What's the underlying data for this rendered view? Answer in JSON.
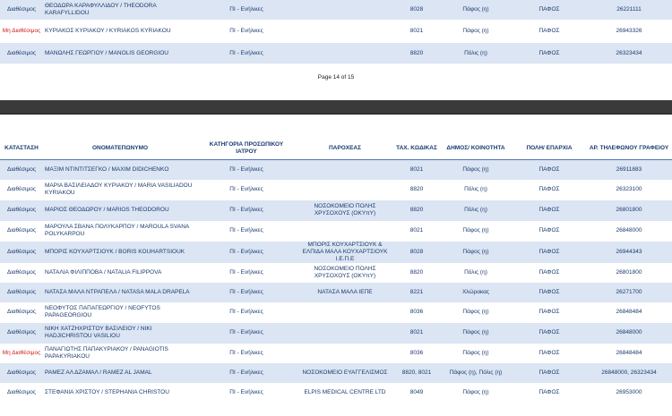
{
  "top_rows": [
    {
      "status": "Διαθέσιμος",
      "name": "ΘΕΟΔΩΡΑ ΚΑΡΑΦΥΛΛΙΔΟΥ / THEODORA KARAFYLLIDOU",
      "category": "ΠΙ - Ενήλικες",
      "provider": "",
      "postcode": "8028",
      "municipality": "Πάφος (η)",
      "district": "ΠΑΦΟΣ",
      "phone": "26221111"
    },
    {
      "status": "Μη Διαθέσιμος",
      "name": "ΚΥΡΙΑΚΟΣ ΚΥΡΙΑΚΟΥ / KYRIAKOS KYRIAKOU",
      "category": "ΠΙ - Ενήλικες",
      "provider": "",
      "postcode": "8021",
      "municipality": "Πάφος (η)",
      "district": "ΠΑΦΟΣ",
      "phone": "26943326"
    },
    {
      "status": "Διαθέσιμος",
      "name": "ΜΑΝΩΛΗΣ ΓΕΩΡΓΙΟΥ / MANOLIS GEORGIOU",
      "category": "ΠΙ - Ενήλικες",
      "provider": "",
      "postcode": "8820",
      "municipality": "Πόλις (η)",
      "district": "ΠΑΦΟΣ",
      "phone": "26323434"
    }
  ],
  "footer": "Page 14 of 15",
  "headers": {
    "status": "ΚΑΤΑΣΤΑΣΗ",
    "name": "ΟΝΟΜΑΤΕΠΩΝΥΜΟ",
    "category": "ΚΑΤΗΓΟΡΙΑ ΠΡΟΣΩΠΙΚΟΥ ΙΑΤΡΟΥ",
    "provider": "ΠΑΡΟΧΕΑΣ",
    "postcode": "ΤΑΧ. ΚΩΔΙΚΑΣ",
    "municipality": "ΔΗΜΟΣ/ ΚΟΙΝΟΤΗΤΑ",
    "district": "ΠΟΛΗ/ ΕΠΑΡΧΙΑ",
    "phone": "ΑΡ. ΤΗΛΕΦΩΝΟΥ ΓΡΑΦΕΙΟΥ"
  },
  "bottom_rows": [
    {
      "status": "Διαθέσιμος",
      "name": "ΜΑΞΙΜ ΝΤΙΝΤΙΤΣΕΓΚΟ / MAXIM DIDICHENKO",
      "category": "ΠΙ - Ενήλικες",
      "provider": "",
      "postcode": "8021",
      "municipality": "Πάφος (η)",
      "district": "ΠΑΦΟΣ",
      "phone": "26911883"
    },
    {
      "status": "Διαθέσιμος",
      "name": "ΜΑΡΙΑ ΒΑΣΙΛΕΙΑΔΟΥ ΚΥΡΙΑΚΟΥ / MARIA VASILIADOU KYRIAKOU",
      "category": "ΠΙ - Ενήλικες",
      "provider": "",
      "postcode": "8820",
      "municipality": "Πόλις (η)",
      "district": "ΠΑΦΟΣ",
      "phone": "26323100"
    },
    {
      "status": "Διαθέσιμος",
      "name": "ΜΑΡΙΟΣ ΘΕΟΔΩΡΟΥ / MARIOS THEODOROU",
      "category": "ΠΙ - Ενήλικες",
      "provider": "ΝΟΣΟΚΟΜΕΙΟ ΠΟΛΗΣ ΧΡΥΣΟΧΟΥΣ (ΟΚΥπΥ)",
      "postcode": "8820",
      "municipality": "Πόλις (η)",
      "district": "ΠΑΦΟΣ",
      "phone": "26801800"
    },
    {
      "status": "Διαθέσιμος",
      "name": "ΜΑΡΟΥΛΑ ΣΒΑΝΑ ΠΟΛΥΚΑΡΠΟΥ / MAROULA SVANA POLYKARPOU",
      "category": "ΠΙ - Ενήλικες",
      "provider": "",
      "postcode": "8021",
      "municipality": "Πάφος (η)",
      "district": "ΠΑΦΟΣ",
      "phone": "26848000"
    },
    {
      "status": "Διαθέσιμος",
      "name": "ΜΠΟΡΙΣ ΚΟΥΧΑΡΤΣΙΟΥΚ / BORIS KOUHARTSIOUK",
      "category": "ΠΙ - Ενήλικες",
      "provider": "ΜΠΟΡΙΣ ΚΟΥΧΑΡΤΣΙΟΥΚ & ΕΛΠΙΔΑ ΜΑΛΑ ΚΟΥΧΑΡΤΣΙΟΥΚ Ι.Ε.Π.Ε",
      "postcode": "8028",
      "municipality": "Πάφος (η)",
      "district": "ΠΑΦΟΣ",
      "phone": "26944343"
    },
    {
      "status": "Διαθέσιμος",
      "name": "ΝΑΤΑΛΙΑ ΦΙΛΙΠΠΟΒΑ / NATALIA FILIPPOVA",
      "category": "ΠΙ - Ενήλικες",
      "provider": "ΝΟΣΟΚΟΜΕΙΟ ΠΟΛΗΣ ΧΡΥΣΟΧΟΥΣ (ΟΚΥπΥ)",
      "postcode": "8820",
      "municipality": "Πόλις (η)",
      "district": "ΠΑΦΟΣ",
      "phone": "26801800"
    },
    {
      "status": "Διαθέσιμος",
      "name": "ΝΑΤΑΣΑ ΜΑΛΑ ΝΤΡΑΠΕΛΑ / NATASA MALA DRAPELA",
      "category": "ΠΙ - Ενήλικες",
      "provider": "ΝΑΤΑΣΑ ΜΑΛΑ ΙΕΠΕ",
      "postcode": "8221",
      "municipality": "Χλώρακας",
      "district": "ΠΑΦΟΣ",
      "phone": "26271700"
    },
    {
      "status": "Διαθέσιμος",
      "name": "ΝΕΟΦΥΤΟΣ ΠΑΠΑΓΕΩΡΓΙΟΥ / NEOFYTOS PAPAGEORGIOU",
      "category": "ΠΙ - Ενήλικες",
      "provider": "",
      "postcode": "8036",
      "municipality": "Πάφος (η)",
      "district": "ΠΑΦΟΣ",
      "phone": "26848484"
    },
    {
      "status": "Διαθέσιμος",
      "name": "ΝΙΚΗ ΧΑΤΖΗΧΡΙΣΤΟΥ ΒΑΣΙΛΕΙΟΥ / NIKI HADJICHRISTOU VASILIOU",
      "category": "ΠΙ - Ενήλικες",
      "provider": "",
      "postcode": "8021",
      "municipality": "Πάφος (η)",
      "district": "ΠΑΦΟΣ",
      "phone": "26848000"
    },
    {
      "status": "Μη Διαθέσιμος",
      "name": "ΠΑΝΑΓΙΩΤΗΣ ΠΑΠΑΚΥΡΙΑΚΟΥ / PANAGIOTIS PAPAKYRIAKOU",
      "category": "ΠΙ - Ενήλικες",
      "provider": "",
      "postcode": "8036",
      "municipality": "Πάφος (η)",
      "district": "ΠΑΦΟΣ",
      "phone": "26848484"
    },
    {
      "status": "Διαθέσιμος",
      "name": "ΡΑΜΕΖ ΑΛ ΔΖΑΜΑΛ / RAMEZ AL JAMAL",
      "category": "ΠΙ - Ενήλικες",
      "provider": "ΝΟΣΟΚΟΜΕΙΟ ΕΥΑΓΓΕΛΙΣΜΟΣ",
      "postcode": "8820, 8021",
      "municipality": "Πάφος (η), Πόλις (η)",
      "district": "ΠΑΦΟΣ",
      "phone": "26848000, 26323434"
    },
    {
      "status": "Διαθέσιμος",
      "name": "ΣΤΕΦΑΝΙΑ ΧΡΙΣΤΟΥ / STEPHANIA CHRISTOU",
      "category": "ΠΙ - Ενήλικες",
      "provider": "ELPIS MEDICAL CENTRE LTD",
      "postcode": "8049",
      "municipality": "Πάφος (η)",
      "district": "ΠΑΦΟΣ",
      "phone": "26953000"
    }
  ]
}
